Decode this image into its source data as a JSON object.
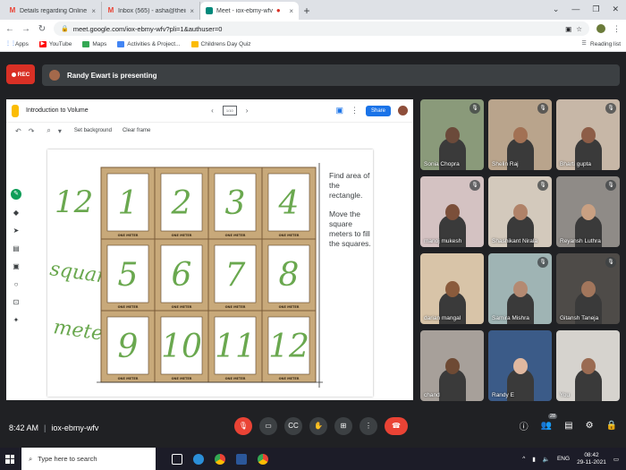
{
  "browser": {
    "tabs": [
      {
        "favicon": "gmail-icon",
        "title": "Details regarding Online Session",
        "active": false
      },
      {
        "favicon": "gmail-icon",
        "title": "Inbox (565) - asha@theindiansch",
        "active": false
      },
      {
        "favicon": "meet-icon",
        "title": "Meet - iox-ebmy-wfv",
        "active": true
      }
    ],
    "url": "meet.google.com/iox-ebmy-wfv?pli=1&authuser=0",
    "bookmarks": [
      {
        "label": "Apps",
        "icon": "apps-icon"
      },
      {
        "label": "YouTube",
        "icon": "youtube-icon",
        "color": "#ff0000"
      },
      {
        "label": "Maps",
        "icon": "maps-icon",
        "color": "#34a853"
      },
      {
        "label": "Activities & Project...",
        "icon": "bookmark-icon",
        "color": "#4285f4"
      },
      {
        "label": "Childrens Day Quiz",
        "icon": "folder-icon",
        "color": "#fbbc04"
      }
    ],
    "reading_list": "Reading list"
  },
  "meet": {
    "rec_label": "REC",
    "presenter_banner": "Randy Ewart is presenting",
    "meeting_code": "iox-ebmy-wfv",
    "time": "8:42 AM",
    "participant_count": "28"
  },
  "jamboard": {
    "title": "Introduction to Volume",
    "share_label": "Share",
    "frame_label": "1/10",
    "set_background": "Set background",
    "clear_frame": "Clear frame",
    "instructions": [
      "Find area of the rectangle.",
      "Move the square meters to fill the squares."
    ],
    "handwriting_side": [
      "12",
      "square",
      "meters"
    ],
    "squares": [
      "1",
      "2",
      "3",
      "4",
      "5",
      "6",
      "7",
      "8",
      "9",
      "10",
      "11",
      "12"
    ],
    "ruler_label": "ONE METER"
  },
  "participants": [
    {
      "name": "Sonia Chopra",
      "muted": true,
      "bg": "#8a9a7a",
      "skin": "#6b4a3a"
    },
    {
      "name": "Shelin Raj",
      "muted": true,
      "bg": "#b9a48c",
      "skin": "#a27154"
    },
    {
      "name": "Bharti gupta",
      "muted": true,
      "bg": "#c7b7a7",
      "skin": "#8d5d47"
    },
    {
      "name": "manoj mukesh",
      "muted": true,
      "bg": "#d4c2c2",
      "skin": "#7b4f3a"
    },
    {
      "name": "Shashikant Nirala",
      "muted": true,
      "bg": "#d3c9bc",
      "skin": "#b08268"
    },
    {
      "name": "Reyansh Luthra",
      "muted": true,
      "bg": "#8f8b87",
      "skin": "#c9a082"
    },
    {
      "name": "darian mangal",
      "muted": false,
      "bg": "#d8c4a8",
      "skin": "#8a5b3c"
    },
    {
      "name": "Samira Mishra",
      "muted": true,
      "bg": "#9fb4b4",
      "skin": "#b48a72"
    },
    {
      "name": "Gitansh Taneja",
      "muted": true,
      "bg": "#4e4b48",
      "skin": "#a2765c"
    },
    {
      "name": "chand",
      "muted": false,
      "bg": "#a7a09a",
      "skin": "#6e4a34"
    },
    {
      "name": "Randy E",
      "muted": false,
      "bg": "#3b5b88",
      "skin": "#e0b8a0"
    },
    {
      "name": "You",
      "muted": false,
      "bg": "#d6d3ce",
      "skin": "#9a6b52"
    }
  ],
  "taskbar": {
    "search_placeholder": "Type here to search",
    "language": "ENG",
    "time": "08:42",
    "date": "29-11-2021"
  }
}
